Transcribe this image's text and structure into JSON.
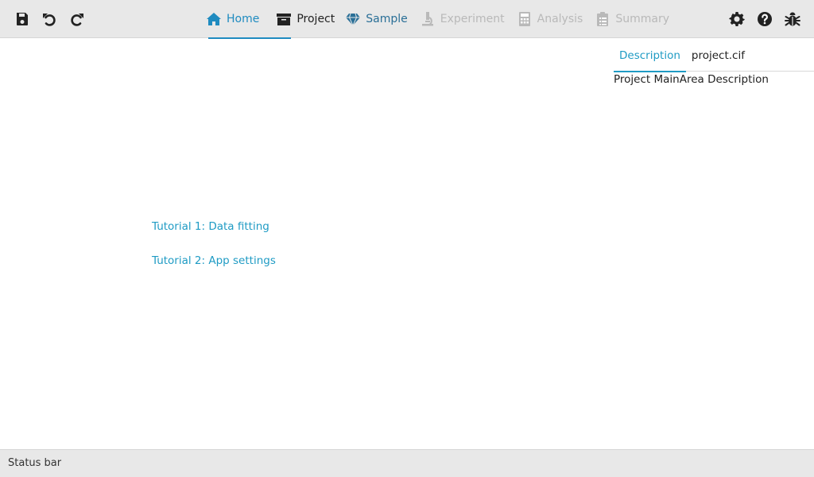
{
  "toolbar": {
    "left_buttons": [
      {
        "icon": "save-icon"
      },
      {
        "icon": "undo-icon"
      },
      {
        "icon": "redo-icon"
      }
    ],
    "tabs": [
      {
        "label": "Home",
        "icon": "home-icon",
        "state": "active"
      },
      {
        "label": "Project",
        "icon": "archive-icon",
        "state": "enabled"
      },
      {
        "label": "Sample",
        "icon": "gem-icon",
        "state": "enabled"
      },
      {
        "label": "Experiment",
        "icon": "microscope-icon",
        "state": "disabled"
      },
      {
        "label": "Analysis",
        "icon": "calculator-icon",
        "state": "disabled"
      },
      {
        "label": "Summary",
        "icon": "clipboard-list-icon",
        "state": "disabled"
      }
    ],
    "right_buttons": [
      {
        "icon": "gear-icon"
      },
      {
        "icon": "question-circle-icon"
      },
      {
        "icon": "bug-icon"
      }
    ]
  },
  "main": {
    "tutorials": [
      {
        "label": "Tutorial 1: Data fitting"
      },
      {
        "label": "Tutorial 2: App settings"
      }
    ]
  },
  "sidebar": {
    "tabs": [
      {
        "label": "Description",
        "state": "active"
      },
      {
        "label": "project.cif",
        "state": "enabled"
      }
    ],
    "description": "Project MainArea Description"
  },
  "statusbar": {
    "text": "Status bar"
  },
  "colors": {
    "accent": "#1f8bc0",
    "link": "#1f9bc4",
    "toolbar_bg": "#e8e8e8",
    "disabled": "#b9b9b9",
    "icon_dark": "#222222"
  }
}
